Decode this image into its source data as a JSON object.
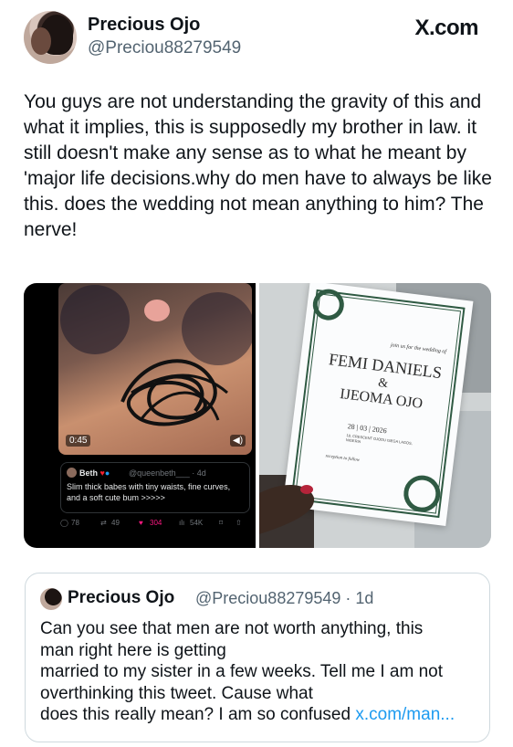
{
  "post": {
    "author_name": "Precious Ojo",
    "author_handle": "@Preciou88279549",
    "site_label": "X.com",
    "text": "You guys are not understanding the gravity of this and what it implies, this is supposedly my brother in law. it still doesn't make any sense as to what he meant by 'major life decisions.why do men have to always be like this. does the wedding not mean anything to him? The nerve!"
  },
  "media": {
    "left_screenshot": {
      "video_time": "0:45",
      "volume_icon": "speaker-icon",
      "embedded_post": {
        "name": "Beth",
        "handle": "@queenbeth___ · 4d",
        "text": "Slim thick babes with tiny waists, fine curves, and a soft cute bum >>>>>"
      },
      "stats": {
        "replies": "78",
        "reposts": "49",
        "likes": "304",
        "views": "54K"
      }
    },
    "right_photo": {
      "for_the_wedding_of": "join us for the wedding of",
      "name_one": "FEMI DANIELS",
      "ampersand": "&",
      "name_two": "IJEOMA OJO",
      "date": "28 | 03 | 2026",
      "address": "18, CRESCENT OJODU ISEGA LAGOS, NIGERIA",
      "reception": "reception to follow"
    }
  },
  "quote": {
    "author_name": "Precious Ojo",
    "meta": "@Preciou88279549 · 1d",
    "text_lines": [
      "Can you see that men are not worth anything, this",
      "man right here is getting",
      "married to my sister in a few weeks. Tell me I am not",
      "overthinking this tweet. Cause what",
      "does this really mean? I am so confused "
    ],
    "link": "x.com/man..."
  },
  "colors": {
    "link": "#1d9bf0",
    "secondary_text": "#536471",
    "like_pink": "#f91880",
    "invite_green": "#2f5a43"
  }
}
